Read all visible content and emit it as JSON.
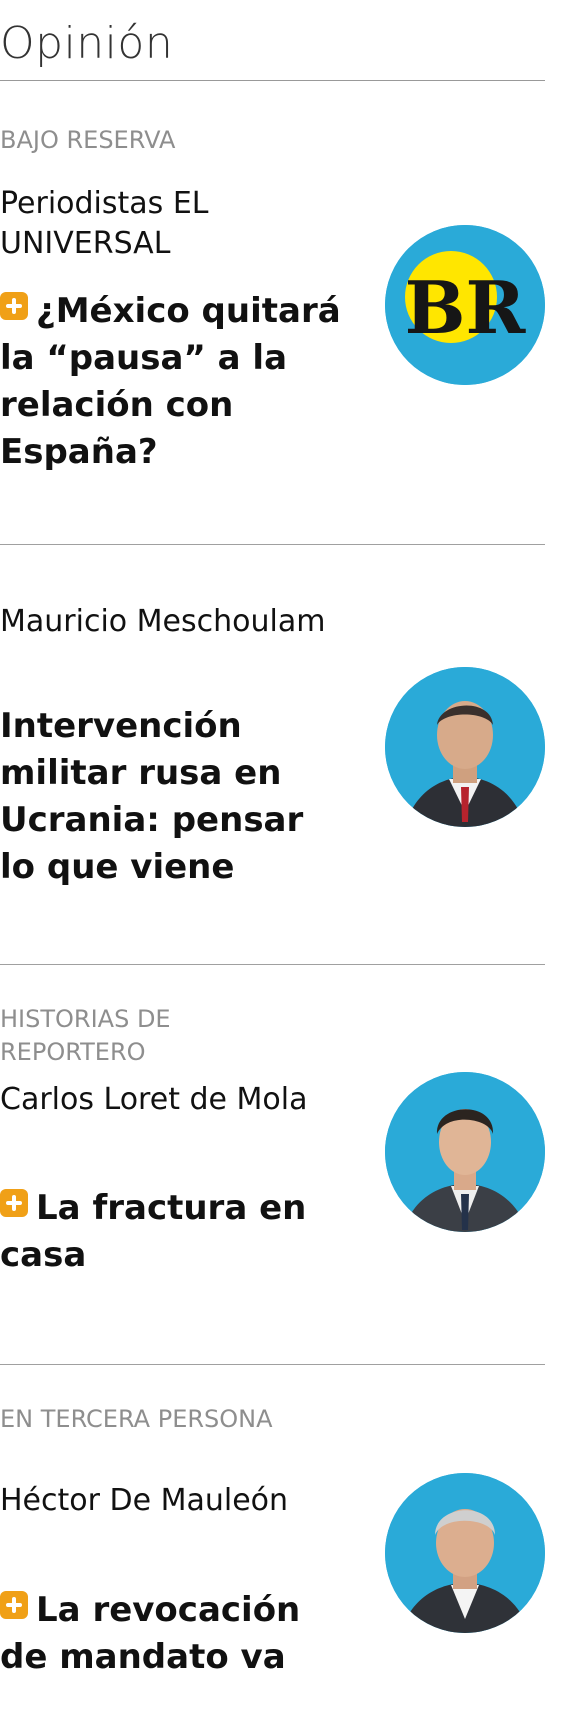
{
  "section_title": "Opinión",
  "colors": {
    "accent_red": "#e31b23",
    "label_gray": "#8e8e8e",
    "avatar_blue": "#2aaad8",
    "badge_orange": "#f0a017"
  },
  "articles": [
    {
      "section": "BAJO RESERVA",
      "author": "Periodistas EL UNIVERSAL",
      "headline": "¿México quitará la “pausa” a la relación con España?",
      "premium": true,
      "avatar_logo_text": "BR"
    },
    {
      "section": "",
      "author": "Mauricio Meschoulam",
      "headline": "Intervención militar rusa en Ucrania: pensar lo que viene",
      "premium": false
    },
    {
      "section": "HISTORIAS DE REPORTERO",
      "author": "Carlos Loret de Mola",
      "headline": "La fractura en casa",
      "premium": true
    },
    {
      "section": "EN TERCERA PERSONA",
      "author": "Héctor De Mauleón",
      "headline": "La revocación de mandato va",
      "premium": true
    }
  ]
}
